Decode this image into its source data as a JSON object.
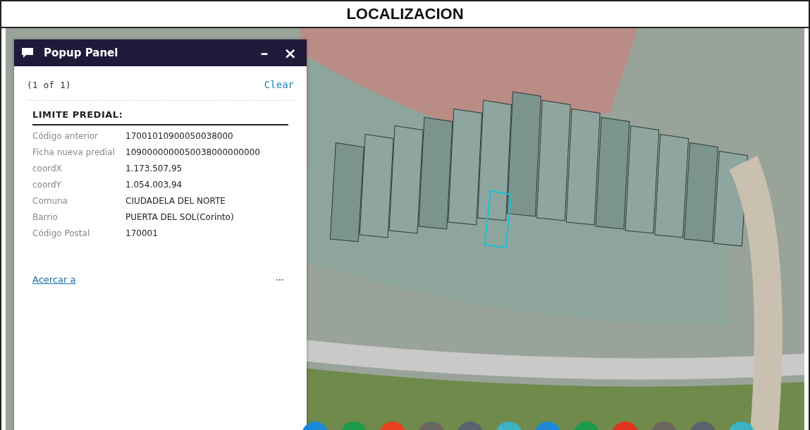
{
  "header": {
    "title": "LOCALIZACION"
  },
  "popup": {
    "title": "Popup Panel",
    "minimize": "–",
    "close": "×",
    "counter": "(1 of 1)",
    "clear": "Clear",
    "section": "LIMITE PREDIAL:",
    "fields": [
      {
        "label": "Código anterior",
        "value": "17001010900050038000"
      },
      {
        "label": "Ficha nueva predial",
        "value": "1090000000050038000000000"
      },
      {
        "label": "coordX",
        "value": "1.173.507,95"
      },
      {
        "label": "coordY",
        "value": "1.054.003,94"
      },
      {
        "label": "Comuna",
        "value": "CIUDADELA DEL NORTE"
      },
      {
        "label": "Barrio",
        "value": "PUERTA DEL SOL(Corinto)"
      },
      {
        "label": "Código Postal",
        "value": "170001"
      }
    ],
    "zoom_link": "Acercar a",
    "more": "•••"
  },
  "dock_buttons": [
    {
      "color": "#1e88d8"
    },
    {
      "color": "#1a9a4a"
    },
    {
      "color": "#e8401e"
    },
    {
      "color": "#6b6660"
    },
    {
      "color": "#59626e"
    },
    {
      "color": "#3ab4c4"
    },
    {
      "color": "#1e88d8"
    },
    {
      "color": "#1a9a4a"
    },
    {
      "color": "#e0321e"
    },
    {
      "color": "#6b6660"
    },
    {
      "color": "#59626e"
    },
    {
      "color": "#3ab4c4"
    }
  ]
}
